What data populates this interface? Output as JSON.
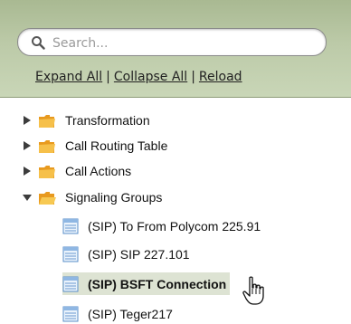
{
  "search": {
    "placeholder": "Search..."
  },
  "links": {
    "expand_all": "Expand All",
    "collapse_all": "Collapse All",
    "reload": "Reload",
    "separator": "|"
  },
  "tree": {
    "nodes": [
      {
        "label": "Transformation",
        "state": "collapsed"
      },
      {
        "label": "Call Routing Table",
        "state": "collapsed"
      },
      {
        "label": "Call Actions",
        "state": "collapsed"
      },
      {
        "label": "Signaling Groups",
        "state": "expanded",
        "children": [
          {
            "label": "(SIP) To From Polycom 225.91"
          },
          {
            "label": "(SIP) SIP 227.101"
          },
          {
            "label": "(SIP) BSFT Connection",
            "selected": true
          },
          {
            "label": "(SIP) Teger217"
          }
        ]
      }
    ]
  },
  "colors": {
    "header_gradient_top": "#a9b992",
    "header_gradient_bottom": "#c9d6b7",
    "selection": "#dde3d3",
    "folder": "#f0b23a"
  }
}
